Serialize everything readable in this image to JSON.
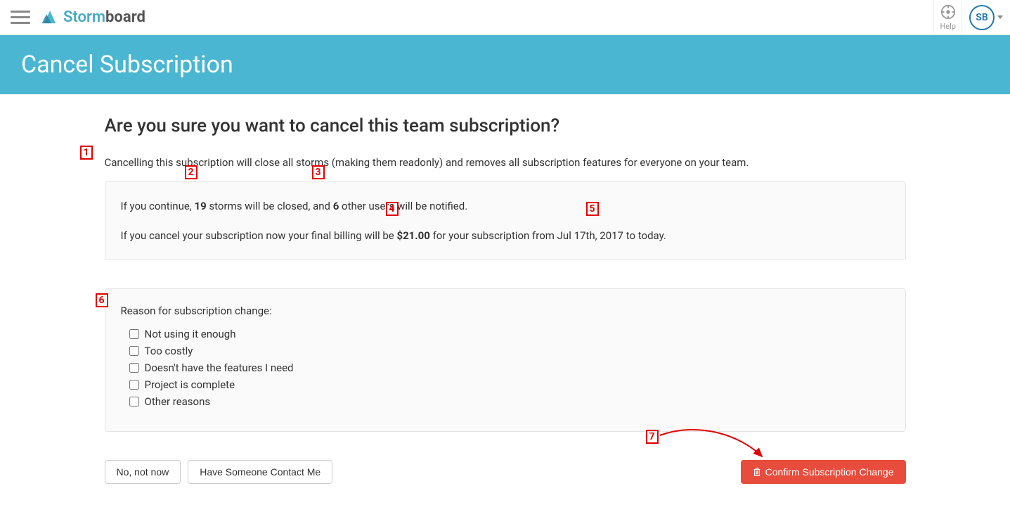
{
  "topbar": {
    "logo_storm": "Storm",
    "logo_board": "board",
    "help_label": "Help",
    "avatar_initials": "SB"
  },
  "banner": {
    "title": "Cancel Subscription"
  },
  "main": {
    "heading": "Are you sure you want to cancel this team subscription?",
    "warning": "Cancelling this subscription will close all storms (making them readonly) and removes all subscription features for everyone on your team.",
    "info_line1_a": "If you continue, ",
    "info_line1_b": " storms will be closed, and ",
    "info_line1_c": " other users will be notified.",
    "storms_count": "19",
    "users_count": "6",
    "info_line2_a": "If you cancel your subscription now your final billing will be ",
    "info_line2_b": " for your subscription from ",
    "info_line2_c": " to today.",
    "final_amount": "$21.00",
    "from_date": "Jul 17th, 2017",
    "reason_heading": "Reason for subscription change:",
    "reasons": [
      "Not using it enough",
      "Too costly",
      "Doesn't have the features I need",
      "Project is complete",
      "Other reasons"
    ],
    "btn_no": "No, not now",
    "btn_contact": "Have Someone Contact Me",
    "btn_confirm": "Confirm Subscription Change"
  },
  "markers": {
    "m1": "1",
    "m2": "2",
    "m3": "3",
    "m4": "4",
    "m5": "5",
    "m6": "6",
    "m7": "7"
  }
}
